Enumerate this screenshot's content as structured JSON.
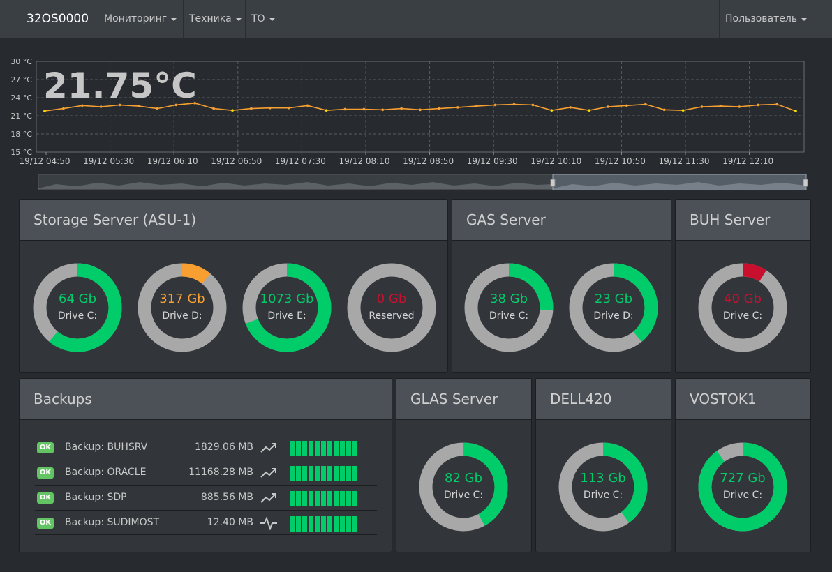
{
  "navbar": {
    "brand": "32OS0000",
    "menu": [
      {
        "label": "Мониторинг"
      },
      {
        "label": "Техника"
      },
      {
        "label": "ТО"
      }
    ],
    "user": "Пользователь"
  },
  "temperature": {
    "current": "21.75°C",
    "chart_data": {
      "type": "line",
      "ylabel": "",
      "xlabel": "",
      "ylim": [
        15,
        30
      ],
      "y_ticks": [
        "30 °C",
        "27 °C",
        "24 °C",
        "21 °C",
        "18 °C",
        "15 °C"
      ],
      "x_ticks": [
        "19/12 04:50",
        "19/12 05:30",
        "19/12 06:10",
        "19/12 06:50",
        "19/12 07:30",
        "19/12 08:10",
        "19/12 08:50",
        "19/12 09:30",
        "19/12 10:10",
        "19/12 10:50",
        "19/12 11:30",
        "19/12 12:10"
      ],
      "series_color": "#f7a031",
      "grid": true,
      "values": [
        21.8,
        22.2,
        22.7,
        22.5,
        22.8,
        22.6,
        22.2,
        22.8,
        23.1,
        22.2,
        21.9,
        22.2,
        22.3,
        22.3,
        22.7,
        21.9,
        22.1,
        22.1,
        22.0,
        22.2,
        22.0,
        22.2,
        22.4,
        22.6,
        22.8,
        22.9,
        22.8,
        21.9,
        22.4,
        21.9,
        22.5,
        22.7,
        22.9,
        22.0,
        21.9,
        22.5,
        22.6,
        22.5,
        22.8,
        22.9,
        21.8
      ]
    }
  },
  "servers": {
    "asu": {
      "title": "Storage Server (ASU-1)",
      "drives": [
        {
          "value": "64 Gb",
          "label": "Drive C:",
          "fill": 0.61,
          "color": "#00cc6a"
        },
        {
          "value": "317 Gb",
          "label": "Drive D:",
          "fill": 0.11,
          "color": "#f7a031"
        },
        {
          "value": "1073 Gb",
          "label": "Drive E:",
          "fill": 0.69,
          "color": "#00cc6a"
        },
        {
          "value": "0 Gb",
          "label": "Reserved",
          "fill": 0.0,
          "color": "#c8102e"
        }
      ]
    },
    "gas": {
      "title": "GAS Server",
      "drives": [
        {
          "value": "38 Gb",
          "label": "Drive C:",
          "fill": 0.26,
          "color": "#00cc6a"
        },
        {
          "value": "23 Gb",
          "label": "Drive D:",
          "fill": 0.39,
          "color": "#00cc6a"
        }
      ]
    },
    "buh": {
      "title": "BUH Server",
      "drives": [
        {
          "value": "40 Gb",
          "label": "Drive C:",
          "fill": 0.09,
          "color": "#c8102e"
        }
      ]
    },
    "glas": {
      "title": "GLAS Server",
      "drives": [
        {
          "value": "82 Gb",
          "label": "Drive C:",
          "fill": 0.42,
          "color": "#00cc6a"
        }
      ]
    },
    "dell": {
      "title": "DELL420",
      "drives": [
        {
          "value": "113 Gb",
          "label": "Drive C:",
          "fill": 0.4,
          "color": "#00cc6a"
        }
      ]
    },
    "vostok": {
      "title": "VOSTOK1",
      "drives": [
        {
          "value": "727 Gb",
          "label": "Drive C:",
          "fill": 0.9,
          "color": "#00cc6a"
        }
      ]
    }
  },
  "backups": {
    "title": "Backups",
    "rows": [
      {
        "status": "OK",
        "name": "Backup: BUHSRV",
        "size": "1829.06 MB",
        "trend_icon": "trending-up-icon",
        "success_bars": 11
      },
      {
        "status": "OK",
        "name": "Backup: ORACLE",
        "size": "11168.28 MB",
        "trend_icon": "trending-up-icon",
        "success_bars": 11
      },
      {
        "status": "OK",
        "name": "Backup: SDP",
        "size": "885.56 MB",
        "trend_icon": "trending-up-icon",
        "success_bars": 11
      },
      {
        "status": "OK",
        "name": "Backup: SUDIMOST",
        "size": "12.40 MB",
        "trend_icon": "activity-pulse-icon",
        "success_bars": 11
      }
    ]
  }
}
